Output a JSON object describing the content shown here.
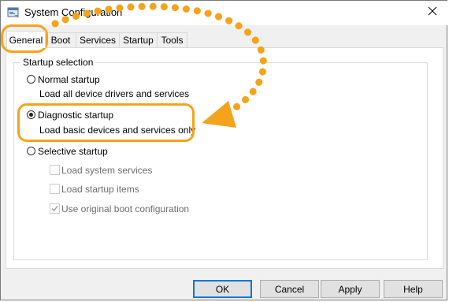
{
  "window": {
    "title": "System Configuration",
    "icon": "msconfig-icon",
    "close_glyph": "✕"
  },
  "tabs": [
    {
      "label": "General",
      "active": true
    },
    {
      "label": "Boot",
      "active": false
    },
    {
      "label": "Services",
      "active": false
    },
    {
      "label": "Startup",
      "active": false
    },
    {
      "label": "Tools",
      "active": false
    }
  ],
  "startup_selection": {
    "group_label": "Startup selection",
    "options": [
      {
        "label": "Normal startup",
        "description": "Load all device drivers and services",
        "selected": false
      },
      {
        "label": "Diagnostic startup",
        "description": "Load basic devices and services only",
        "selected": true
      },
      {
        "label": "Selective startup",
        "selected": false
      }
    ],
    "selective_items": [
      {
        "label": "Load system services",
        "checked": false,
        "enabled": false
      },
      {
        "label": "Load startup items",
        "checked": false,
        "enabled": false
      },
      {
        "label": "Use original boot configuration",
        "checked": true,
        "enabled": false
      }
    ]
  },
  "buttons": {
    "ok": "OK",
    "cancel": "Cancel",
    "apply": "Apply",
    "help": "Help"
  },
  "annotation": {
    "color": "#f5a31a"
  }
}
